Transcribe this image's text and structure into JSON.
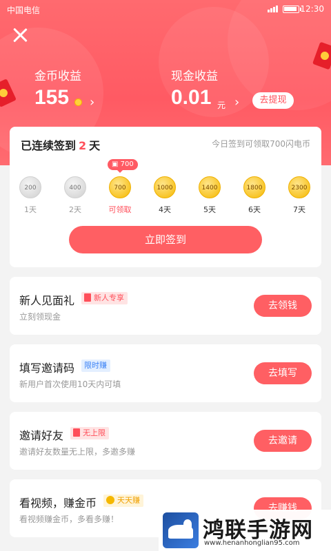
{
  "status_bar": {
    "carrier": "中国电信",
    "time": "12:30"
  },
  "earnings": {
    "coin_label": "金币收益",
    "coin_value": "155",
    "cash_label": "现金收益",
    "cash_value": "0.01",
    "cash_unit": "元",
    "withdraw_label": "去提现",
    "chevron": "›"
  },
  "signin": {
    "title_prefix": "已连续签到",
    "days": "2",
    "title_suffix": "天",
    "hint": "今日签到可领取700闪电币",
    "badge": "700",
    "button_label": "立即签到",
    "days_list": [
      {
        "value": "200",
        "label": "1天",
        "state": "done"
      },
      {
        "value": "400",
        "label": "2天",
        "state": "done"
      },
      {
        "value": "700",
        "label": "可领取",
        "state": "available"
      },
      {
        "value": "1000",
        "label": "4天",
        "state": "upcoming"
      },
      {
        "value": "1400",
        "label": "5天",
        "state": "upcoming"
      },
      {
        "value": "1800",
        "label": "6天",
        "state": "upcoming"
      },
      {
        "value": "2300",
        "label": "7天",
        "state": "upcoming"
      }
    ]
  },
  "tasks": [
    {
      "title": "新人见面礼",
      "tag": "新人专享",
      "tag_color": "red",
      "subtitle": "立刻领现金",
      "button": "去领钱"
    },
    {
      "title": "填写邀请码",
      "tag": "限时赚",
      "tag_color": "blue",
      "subtitle": "新用户首次使用10天内可填",
      "button": "去填写"
    },
    {
      "title": "邀请好友",
      "tag": "无上限",
      "tag_color": "red",
      "subtitle": "邀请好友数量无上限，多邀多赚",
      "button": "去邀请"
    },
    {
      "title": "看视频，赚金币",
      "tag": "天天赚",
      "tag_color": "yellow",
      "subtitle": "看视频赚金币，多看多赚！",
      "button": "去赚钱"
    }
  ],
  "watermark": {
    "name": "鸿联手游网",
    "url": "www.henanhonglian95.com"
  },
  "colors": {
    "accent": "#ff5a63",
    "gold": "#f5b800"
  }
}
